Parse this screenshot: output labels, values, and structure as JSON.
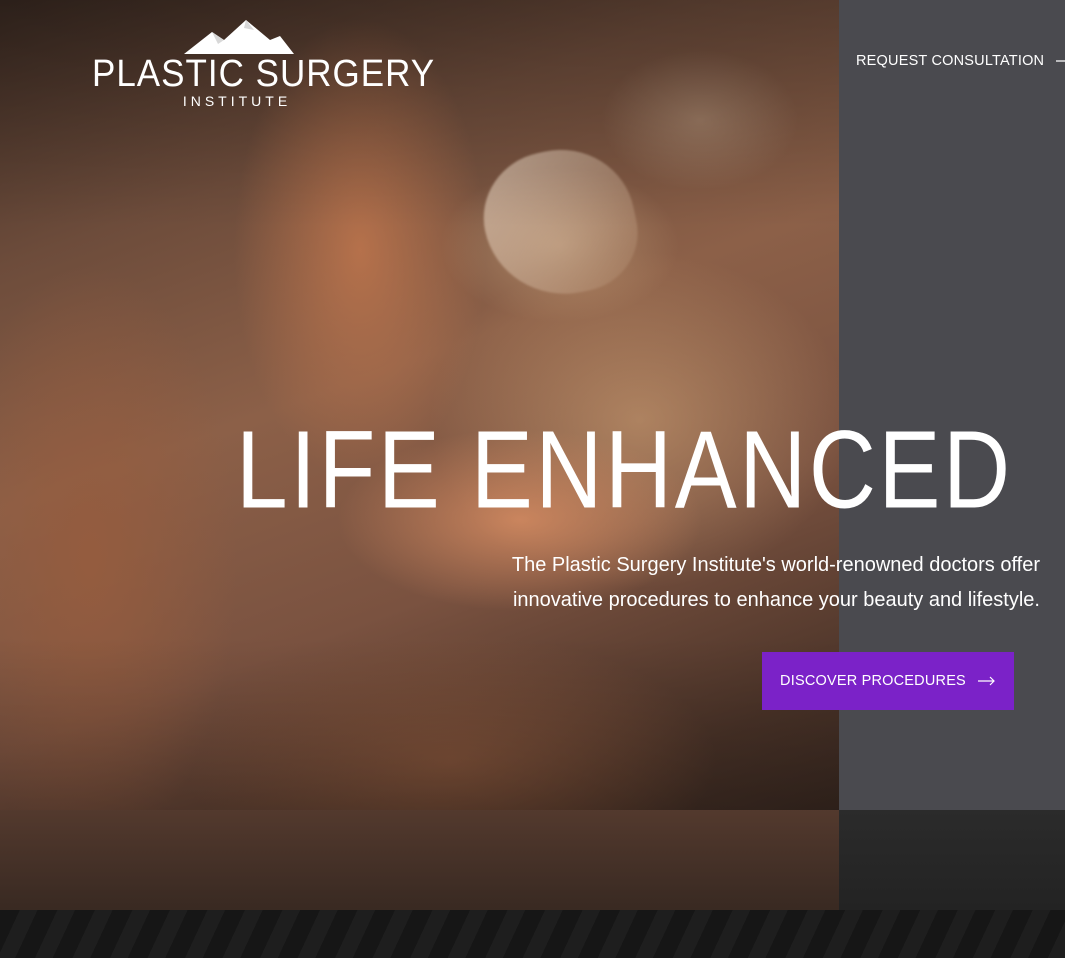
{
  "header": {
    "logo": {
      "main_text": "PLASTIC SURGERY",
      "sub_text": "INSTITUTE"
    },
    "consult_link_label": "REQUEST CONSULTATION"
  },
  "hero": {
    "headline": "LIFE ENHANCED",
    "subtitle_line1": "The Plastic Surgery Institute's world-renowned doctors offer",
    "subtitle_line2": "innovative procedures to enhance your beauty and lifestyle.",
    "cta_label": "DISCOVER PROCEDURES"
  },
  "colors": {
    "accent": "#7b22c8",
    "side_panel": "#4a4a4f",
    "text": "#ffffff"
  },
  "icons": {
    "logo_mark": "mountain-icon",
    "consult_arrow": "arrow-right-icon",
    "cta_arrow": "arrow-right-icon"
  }
}
